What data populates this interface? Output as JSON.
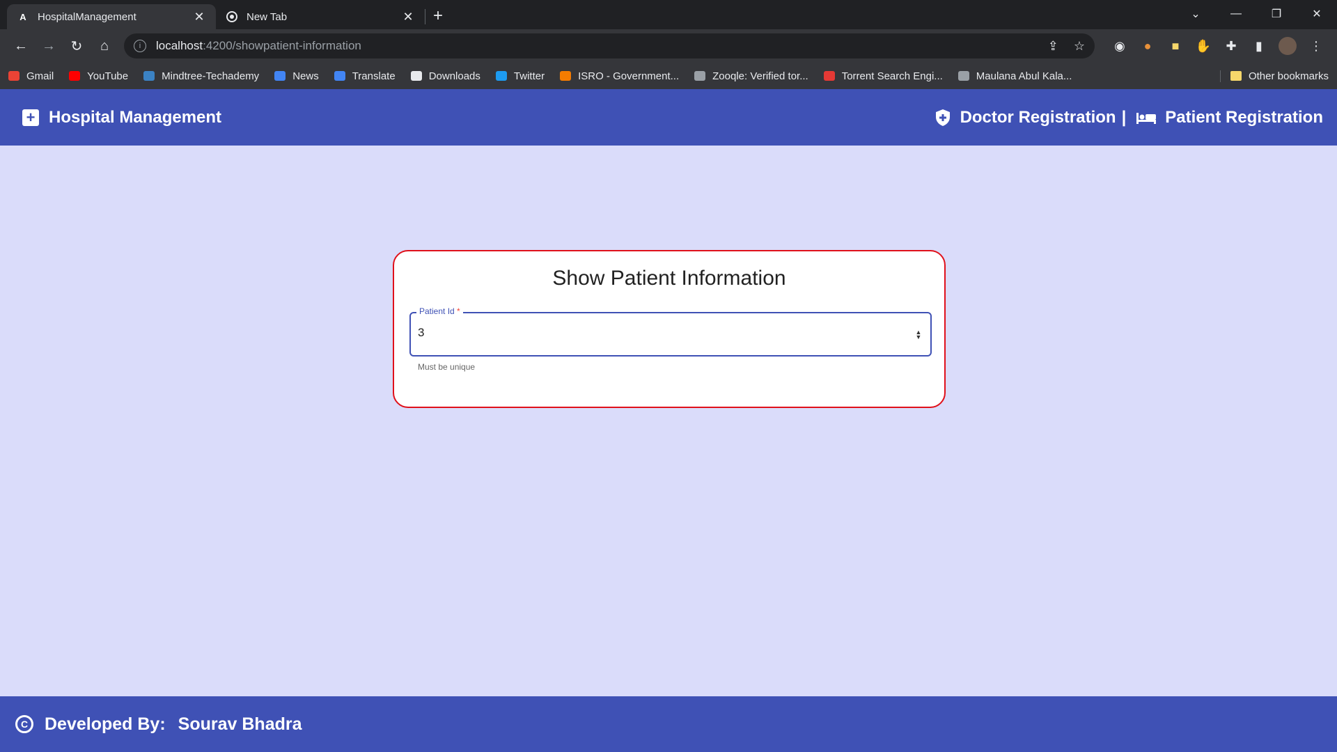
{
  "browser": {
    "tabs": [
      {
        "title": "HospitalManagement",
        "icon": "angular-icon",
        "active": true
      },
      {
        "title": "New Tab",
        "icon": "chrome-icon",
        "active": false
      }
    ],
    "url_host": "localhost",
    "url_path": ":4200/showpatient-information",
    "bookmarks": [
      {
        "label": "Gmail",
        "icon": "gmail-icon",
        "color": "#ea4335"
      },
      {
        "label": "YouTube",
        "icon": "youtube-icon",
        "color": "#ff0000"
      },
      {
        "label": "Mindtree-Techademy",
        "icon": "mindtree-icon",
        "color": "#3b82c4"
      },
      {
        "label": "News",
        "icon": "google-news-icon",
        "color": "#4285f4"
      },
      {
        "label": "Translate",
        "icon": "translate-icon",
        "color": "#4285f4"
      },
      {
        "label": "Downloads",
        "icon": "download-icon",
        "color": "#e8eaed"
      },
      {
        "label": "Twitter",
        "icon": "twitter-icon",
        "color": "#1d9bf0"
      },
      {
        "label": "ISRO - Government...",
        "icon": "isro-icon",
        "color": "#f57c00"
      },
      {
        "label": "Zooqle: Verified tor...",
        "icon": "zooqle-icon",
        "color": "#9aa0a6"
      },
      {
        "label": "Torrent Search Engi...",
        "icon": "torrent-icon",
        "color": "#e53935"
      },
      {
        "label": "Maulana Abul Kala...",
        "icon": "graduation-cap-icon",
        "color": "#9aa0a6"
      }
    ],
    "other_bookmarks": "Other bookmarks"
  },
  "app": {
    "brand": "Hospital Management",
    "nav_doctor": "Doctor Registration",
    "nav_separator": "|",
    "nav_patient": "Patient Registration",
    "accent_color": "#3f51b5",
    "background_color": "#dadcfa"
  },
  "form": {
    "title": "Show Patient Information",
    "field_label": "Patient Id",
    "required_mark": "*",
    "field_value": "3",
    "hint": "Must be unique",
    "border_color": "#e0101a"
  },
  "footer": {
    "prefix": "Developed By:",
    "author": "Sourav Bhadra"
  }
}
